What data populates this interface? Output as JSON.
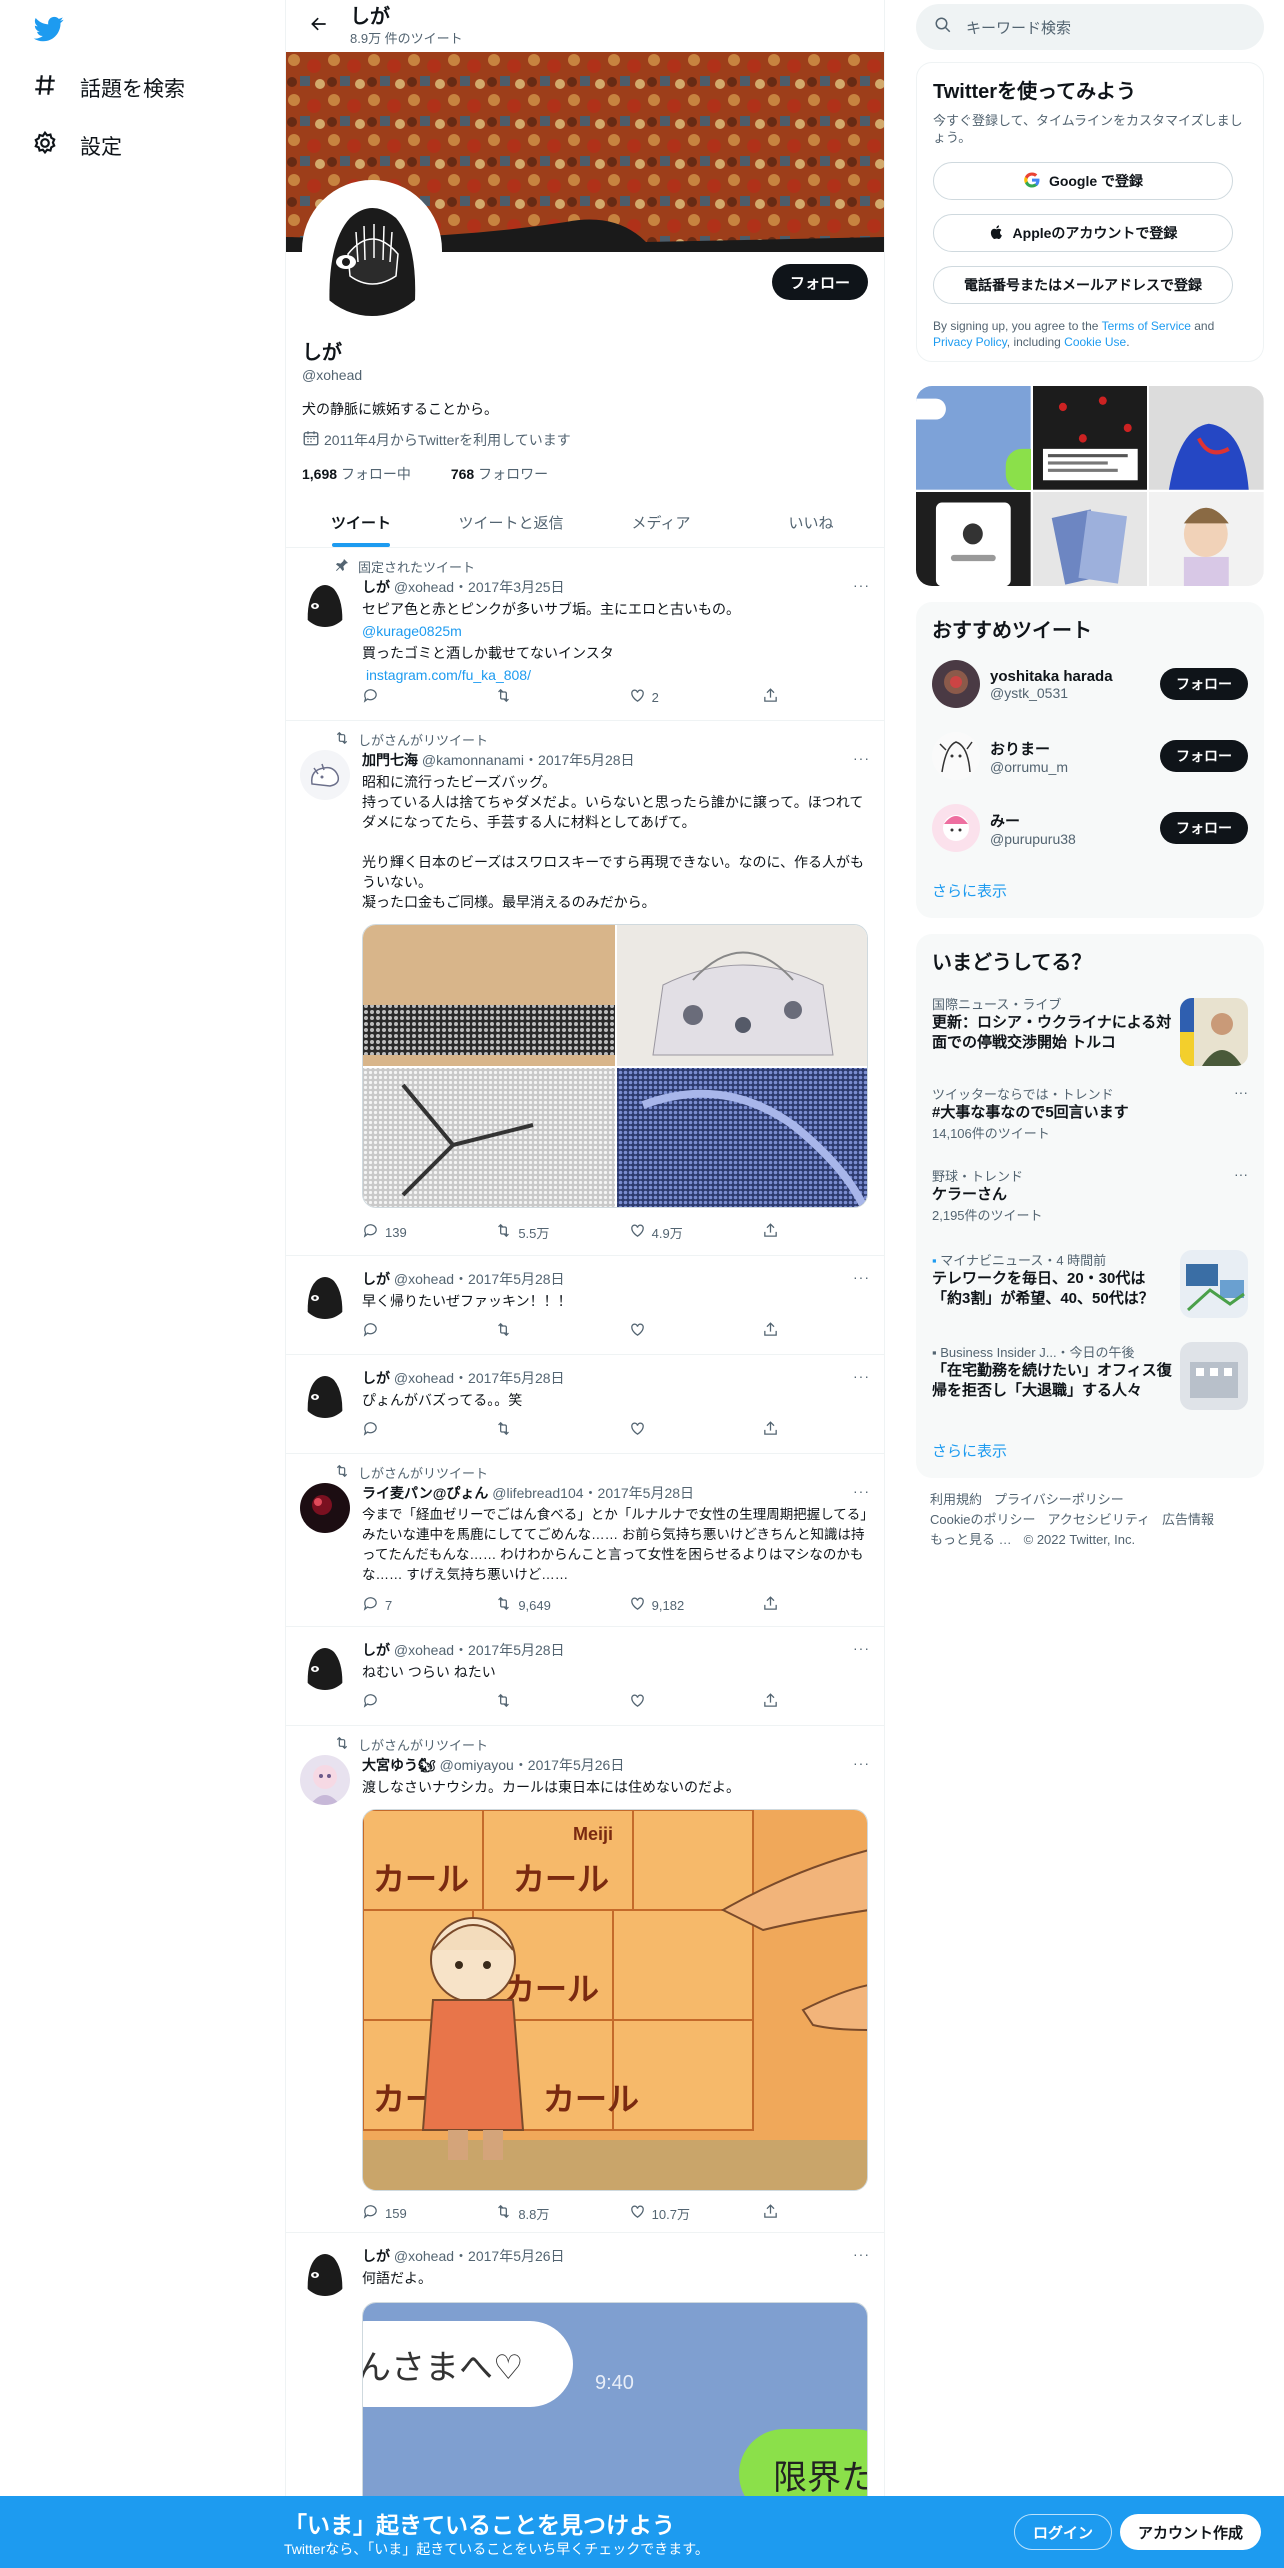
{
  "colors": {
    "accent": "#1d9bf0",
    "dark": "#0f1419",
    "muted": "#536471",
    "border": "#eff3f4"
  },
  "nav": {
    "logo_icon": "twitter-bird-icon",
    "items": [
      {
        "label": "話題を検索",
        "icon": "hash-icon"
      },
      {
        "label": "設定",
        "icon": "gear-icon"
      }
    ]
  },
  "header": {
    "name": "しが",
    "tweet_count": "8.9万 件のツイート"
  },
  "profile": {
    "follow_label": "フォロー",
    "name": "しが",
    "handle": "@xohead",
    "bio": "犬の静脈に嫉妬することから。",
    "joined": "2011年4月からTwitterを利用しています",
    "following_count": "1,698",
    "following_label": "フォロー中",
    "followers_count": "768",
    "followers_label": "フォロワー"
  },
  "tabs": [
    {
      "label": "ツイート"
    },
    {
      "label": "ツイートと返信"
    },
    {
      "label": "メディア"
    },
    {
      "label": "いいね"
    }
  ],
  "tweets": [
    {
      "context": "固定されたツイート",
      "name": "しが",
      "handle": "@xohead",
      "date": "・2017年3月25日",
      "text": "セピア色と赤とピンクが多いサブ垢。主にエロと古いもの。",
      "link1": "@kurage0825m",
      "text2": "買ったゴミと酒しか載せてないインスタ",
      "link2": "instagram.com/fu_ka_808/",
      "replies": "",
      "retweets": "",
      "likes": "2"
    },
    {
      "context": "しがさんがリツイート",
      "name": "加門七海",
      "handle": "@kamonnanami",
      "date": "・2017年5月28日",
      "text": "昭和に流行ったビーズバッグ。\n持っている人は捨てちゃダメだよ。いらないと思ったら誰かに譲って。ほつれてダメになってたら、手芸する人に材料としてあげて。\n\n光り輝く日本のビーズはスワロスキーですら再現できない。なのに、作る人がもういない。\n凝った口金もご同様。最早消えるのみだから。",
      "replies": "139",
      "retweets": "5.5万",
      "likes": "4.9万"
    },
    {
      "name": "しが",
      "handle": "@xohead",
      "date": "・2017年5月28日",
      "text": "早く帰りたいぜファッキン！！！",
      "replies": "",
      "retweets": "",
      "likes": ""
    },
    {
      "name": "しが",
      "handle": "@xohead",
      "date": "・2017年5月28日",
      "text": "ぴょんがバズってる。。笑",
      "replies": "",
      "retweets": "",
      "likes": ""
    },
    {
      "context": "しがさんがリツイート",
      "name": "ライ麦パン@ぴょん",
      "handle": "@lifebread104",
      "date": "・2017年5月28日",
      "text": "今まで「経血ゼリーでごはん食べる」とか「ルナルナで女性の生理周期把握してる」みたいな連中を馬鹿にしててごめんな…… お前ら気持ち悪いけどきちんと知識は持ってたんだもんな…… わけわからんこと言って女性を困らせるよりはマシなのかもな…… すげえ気持ち悪いけど……",
      "replies": "7",
      "retweets": "9,649",
      "likes": "9,182"
    },
    {
      "name": "しが",
      "handle": "@xohead",
      "date": "・2017年5月28日",
      "text": "ねむい つらい ねたい",
      "replies": "",
      "retweets": "",
      "likes": ""
    },
    {
      "context": "しがさんがリツイート",
      "name": "大宮ゆう🐿",
      "handle": "@omiyayou",
      "date": "・2017年5月26日",
      "text": "渡しなさいナウシカ。カールは東日本には住めないのだよ。",
      "media_text1": "Meiji",
      "media_text2": "カール",
      "replies": "159",
      "retweets": "8.8万",
      "likes": "10.7万"
    },
    {
      "name": "しが",
      "handle": "@xohead",
      "date": "・2017年5月26日",
      "text": "何語だよ。",
      "media_text1": "んさまへ♡",
      "media_text2": "9:40",
      "media_text3": "限界た"
    }
  ],
  "right": {
    "search_placeholder": "キーワード検索",
    "signup": {
      "title": "Twitterを使ってみよう",
      "desc": "今すぐ登録して、タイムラインをカスタマイズしましょう。",
      "google": "Google で登録",
      "apple": "Appleのアカウントで登録",
      "phone": "電話番号またはメールアドレスで登録",
      "tos_pre": "By signing up, you agree to the ",
      "tos_terms": "Terms of Service",
      "tos_and": " and ",
      "tos_privacy": "Privacy Policy",
      "tos_mid": ", including ",
      "tos_cookie": "Cookie Use",
      "tos_end": "."
    },
    "recommended": {
      "title": "おすすめツイート",
      "follow_label": "フォロー",
      "users": [
        {
          "name": "yoshitaka harada",
          "handle": "@ystk_0531"
        },
        {
          "name": "おりまー",
          "handle": "@orrumu_m"
        },
        {
          "name": "みー",
          "handle": "@purupuru38"
        }
      ],
      "show_more": "さらに表示"
    },
    "trends": {
      "title": "いまどうしてる？",
      "items": [
        {
          "meta": "国際ニュース・ライブ",
          "title": "更新：ロシア・ウクライナによる対面での停戦交渉開始 トルコ",
          "count": ""
        },
        {
          "meta": "ツイッターならでは・トレンド",
          "title": "#大事な事なので5回言います",
          "count": "14,106件のツイート"
        },
        {
          "meta": "野球・トレンド",
          "title": "ケラーさん",
          "count": "2,195件のツイート"
        },
        {
          "meta": "マイナビニュース・4 時間前",
          "title": "テレワークを毎日、20・30代は「約3割」が希望、40、50代は？",
          "count": ""
        },
        {
          "meta": "Business Insider J...・今日の午後",
          "title": "「在宅勤務を続けたい」オフィス復帰を拒否し「大退職」する人々",
          "count": ""
        }
      ],
      "more_label": "···",
      "show_more": "さらに表示"
    },
    "footer": [
      "利用規約",
      "プライバシーポリシー",
      "Cookieのポリシー",
      "アクセシビリティ",
      "広告情報",
      "もっと見る …",
      "© 2022 Twitter, Inc."
    ]
  },
  "bottom": {
    "title": "「いま」起きていることを見つけよう",
    "subtitle": "Twitterなら、「いま」起きていることをいち早くチェックできます。",
    "login": "ログイン",
    "signup": "アカウント作成"
  }
}
